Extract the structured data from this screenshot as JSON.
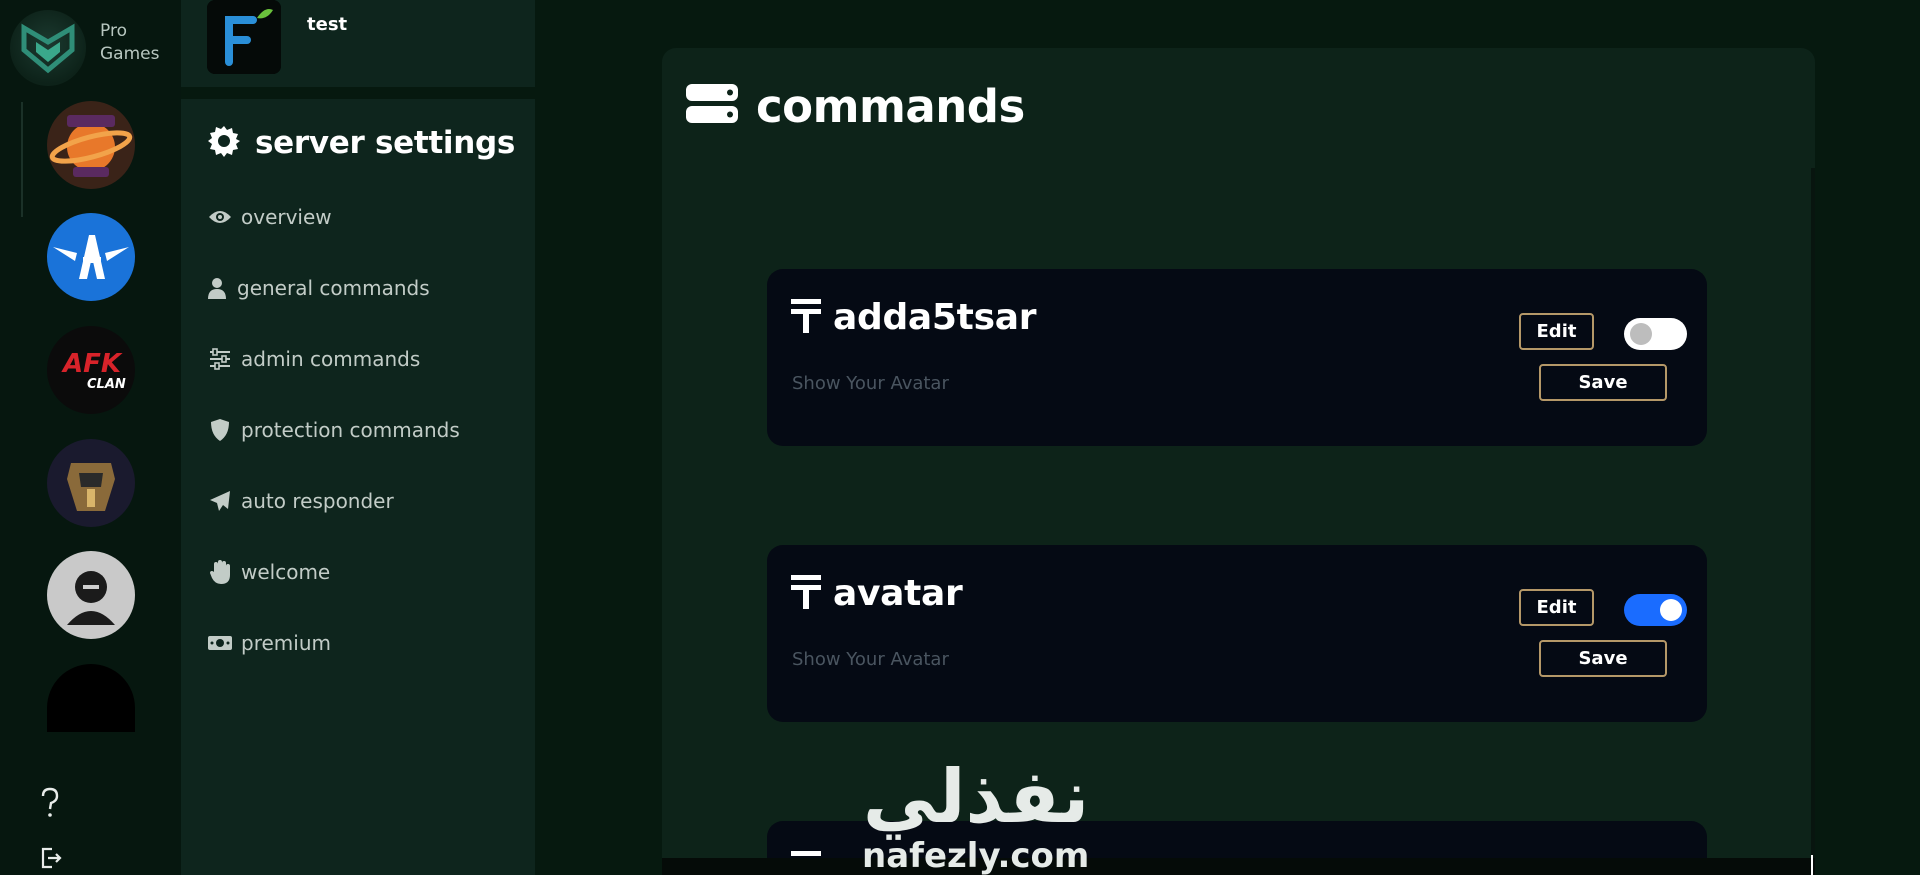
{
  "brand": {
    "line1": "Pro",
    "line2": "Games"
  },
  "rail": {
    "servers": [
      {
        "name": "royal-planet-server"
      },
      {
        "name": "a-wings-server"
      },
      {
        "name": "afk-clan-server"
      },
      {
        "name": "knight-server"
      },
      {
        "name": "unknown-clan-server"
      },
      {
        "name": "black-server"
      }
    ],
    "help_icon": "question-icon",
    "logout_icon": "logout-icon"
  },
  "server": {
    "name": "test"
  },
  "settings": {
    "title": "server settings",
    "nav": [
      {
        "label": "overview",
        "icon": "eye-icon"
      },
      {
        "label": "general commands",
        "icon": "user-icon"
      },
      {
        "label": "admin commands",
        "icon": "sliders-icon"
      },
      {
        "label": "protection commands",
        "icon": "shield-icon"
      },
      {
        "label": "auto responder",
        "icon": "paper-plane-icon"
      },
      {
        "label": "welcome",
        "icon": "hand-icon"
      },
      {
        "label": "premium",
        "icon": "money-icon"
      }
    ]
  },
  "main": {
    "title": "commands",
    "commands": [
      {
        "name": "adda5tsar",
        "description": "Show Your Avatar",
        "edit_label": "Edit",
        "save_label": "Save",
        "enabled": false
      },
      {
        "name": "avatar",
        "description": "Show Your Avatar",
        "edit_label": "Edit",
        "save_label": "Save",
        "enabled": true
      }
    ]
  },
  "watermark": {
    "arabic": "نفذلي",
    "latin": "nafezly.com"
  },
  "colors": {
    "accent": "#1a6cff",
    "button_border": "#b59868",
    "card_bg": "#050a14",
    "panel_bg": "#0d2319",
    "sidebar_bg": "#0e251d"
  }
}
